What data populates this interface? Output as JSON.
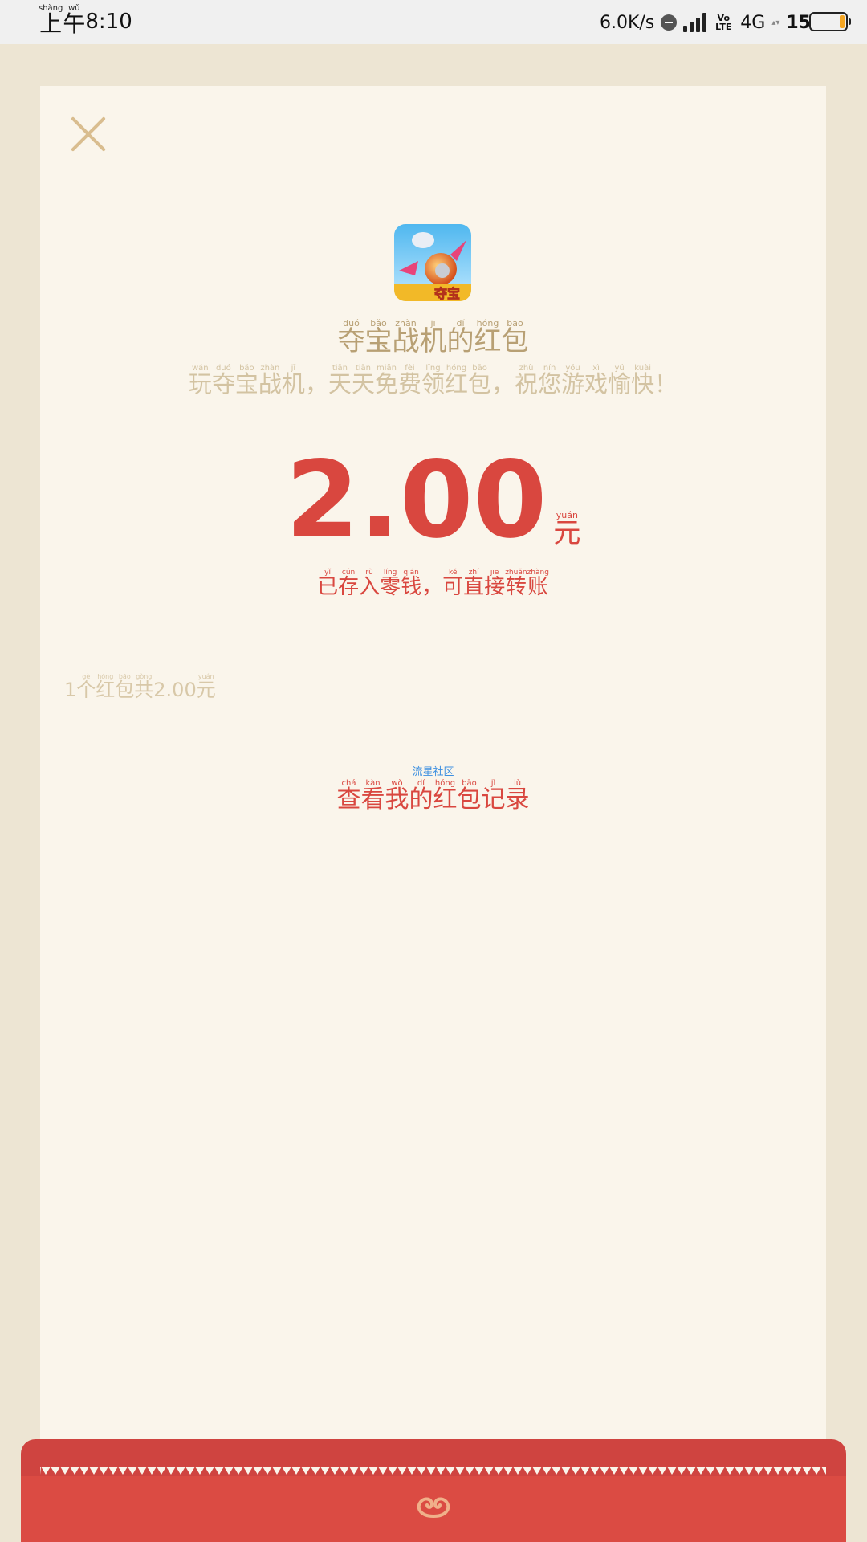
{
  "status_bar": {
    "time_prefix_pinyin": [
      "shàng",
      "wǔ"
    ],
    "time_prefix_chars": [
      "上",
      "午"
    ],
    "time": "8:10",
    "net_speed": "6.0K/s",
    "volte": "Vo LTE",
    "network": "4G",
    "battery_level": "15"
  },
  "envelope": {
    "title": [
      {
        "py": "duó",
        "ch": "夺"
      },
      {
        "py": "bǎo",
        "ch": "宝"
      },
      {
        "py": "zhàn",
        "ch": "战"
      },
      {
        "py": "jī",
        "ch": "机"
      },
      {
        "py": "dí",
        "ch": "的"
      },
      {
        "py": "hóng",
        "ch": "红"
      },
      {
        "py": "bāo",
        "ch": "包"
      }
    ],
    "subtitle": [
      {
        "py": "wán",
        "ch": "玩"
      },
      {
        "py": "duó",
        "ch": "夺"
      },
      {
        "py": "bǎo",
        "ch": "宝"
      },
      {
        "py": "zhàn",
        "ch": "战"
      },
      {
        "py": "jī",
        "ch": "机"
      },
      {
        "py": "",
        "ch": "，"
      },
      {
        "py": "tiān",
        "ch": "天"
      },
      {
        "py": "tiān",
        "ch": "天"
      },
      {
        "py": "miǎn",
        "ch": "免"
      },
      {
        "py": "fèi",
        "ch": "费"
      },
      {
        "py": "lǐng",
        "ch": "领"
      },
      {
        "py": "hóng",
        "ch": "红"
      },
      {
        "py": "bāo",
        "ch": "包"
      },
      {
        "py": "",
        "ch": "，"
      },
      {
        "py": "zhù",
        "ch": "祝"
      },
      {
        "py": "nín",
        "ch": "您"
      },
      {
        "py": "yóu",
        "ch": "游"
      },
      {
        "py": "xì",
        "ch": "戏"
      },
      {
        "py": "yú",
        "ch": "愉"
      },
      {
        "py": "kuài",
        "ch": "快"
      },
      {
        "py": "",
        "ch": "！"
      }
    ],
    "amount": "2.00",
    "unit": {
      "py": "yuán",
      "ch": "元"
    },
    "saved_note": [
      {
        "py": "yǐ",
        "ch": "已"
      },
      {
        "py": "cún",
        "ch": "存"
      },
      {
        "py": "rù",
        "ch": "入"
      },
      {
        "py": "líng",
        "ch": "零"
      },
      {
        "py": "qián",
        "ch": "钱"
      },
      {
        "py": "",
        "ch": "，"
      },
      {
        "py": "kě",
        "ch": "可"
      },
      {
        "py": "zhí",
        "ch": "直"
      },
      {
        "py": "jiē",
        "ch": "接"
      },
      {
        "py": "zhuǎn",
        "ch": "转"
      },
      {
        "py": "zhàng",
        "ch": "账"
      }
    ],
    "count_summary": [
      {
        "py": "",
        "ch": "1"
      },
      {
        "py": "gè",
        "ch": "个"
      },
      {
        "py": "hóng",
        "ch": "红"
      },
      {
        "py": "bāo",
        "ch": "包"
      },
      {
        "py": "gòng",
        "ch": "共"
      },
      {
        "py": "",
        "ch": "2.00"
      },
      {
        "py": "yuán",
        "ch": "元"
      }
    ],
    "watermark": "流星社区",
    "record_link": [
      {
        "py": "chá",
        "ch": "查"
      },
      {
        "py": "kàn",
        "ch": "看"
      },
      {
        "py": "wǒ",
        "ch": "我"
      },
      {
        "py": "dí",
        "ch": "的"
      },
      {
        "py": "hóng",
        "ch": "红"
      },
      {
        "py": "bāo",
        "ch": "包"
      },
      {
        "py": "jì",
        "ch": "记"
      },
      {
        "py": "lù",
        "ch": "录"
      }
    ]
  },
  "colors": {
    "accent_red": "#d9473f",
    "gold": "#b8a074",
    "card_bg": "#faf5eb",
    "page_bg": "#ede5d3"
  },
  "icons": [
    "close-icon",
    "app-icon",
    "envelope-logo-icon",
    "battery-icon",
    "signal-icon",
    "dnd-icon"
  ]
}
